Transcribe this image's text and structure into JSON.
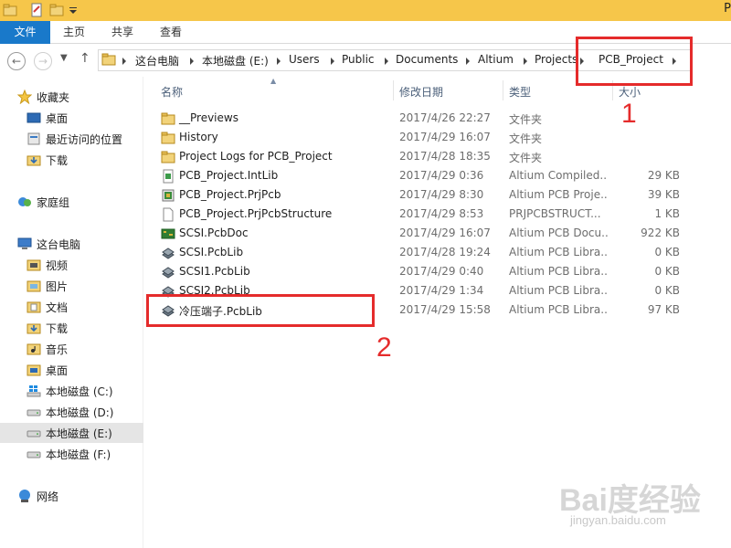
{
  "window": {
    "title_partial": "P"
  },
  "ribbon": {
    "tabs": [
      "文件",
      "主页",
      "共享",
      "查看"
    ]
  },
  "address": {
    "crumbs": [
      "这台电脑",
      "本地磁盘 (E:)",
      "Users",
      "Public",
      "Documents",
      "Altium",
      "Projects",
      "PCB_Project"
    ]
  },
  "sidebar": {
    "favorites": {
      "label": "收藏夹",
      "items": [
        "桌面",
        "最近访问的位置",
        "下载"
      ]
    },
    "homegroup": "家庭组",
    "thispc": {
      "label": "这台电脑",
      "items": [
        "视频",
        "图片",
        "文档",
        "下载",
        "音乐",
        "桌面",
        "本地磁盘 (C:)",
        "本地磁盘 (D:)",
        "本地磁盘 (E:)",
        "本地磁盘 (F:)"
      ],
      "selected": "本地磁盘 (E:)"
    },
    "network": "网络"
  },
  "filelist": {
    "columns": [
      "名称",
      "修改日期",
      "类型",
      "大小"
    ],
    "rows": [
      {
        "name": "__Previews",
        "date": "2017/4/26 22:27",
        "type": "文件夹",
        "size": "",
        "icon": "folder-icon"
      },
      {
        "name": "History",
        "date": "2017/4/29 16:07",
        "type": "文件夹",
        "size": "",
        "icon": "folder-icon"
      },
      {
        "name": "Project Logs for PCB_Project",
        "date": "2017/4/28 18:35",
        "type": "文件夹",
        "size": "",
        "icon": "folder-icon"
      },
      {
        "name": "PCB_Project.IntLib",
        "date": "2017/4/29 0:36",
        "type": "Altium Compiled...",
        "size": "29 KB",
        "icon": "intlib-icon"
      },
      {
        "name": "PCB_Project.PrjPcb",
        "date": "2017/4/29 8:30",
        "type": "Altium PCB Proje...",
        "size": "39 KB",
        "icon": "prjpcb-icon"
      },
      {
        "name": "PCB_Project.PrjPcbStructure",
        "date": "2017/4/29 8:53",
        "type": "PRJPCBSTRUCT...",
        "size": "1 KB",
        "icon": "blank-file-icon"
      },
      {
        "name": "SCSI.PcbDoc",
        "date": "2017/4/29 16:07",
        "type": "Altium PCB Docu...",
        "size": "922 KB",
        "icon": "pcbdoc-icon"
      },
      {
        "name": "SCSI.PcbLib",
        "date": "2017/4/28 19:24",
        "type": "Altium PCB Libra...",
        "size": "0 KB",
        "icon": "pcblib-icon"
      },
      {
        "name": "SCSI1.PcbLib",
        "date": "2017/4/29 0:40",
        "type": "Altium PCB Libra...",
        "size": "0 KB",
        "icon": "pcblib-icon"
      },
      {
        "name": "SCSI2.PcbLib",
        "date": "2017/4/29 1:34",
        "type": "Altium PCB Libra...",
        "size": "0 KB",
        "icon": "pcblib-icon"
      },
      {
        "name": "冷压端子.PcbLib",
        "date": "2017/4/29 15:58",
        "type": "Altium PCB Libra...",
        "size": "97 KB",
        "icon": "pcblib-icon"
      }
    ]
  },
  "annotations": {
    "label1": "1",
    "label2": "2",
    "color": "#e52b2b"
  },
  "watermark": {
    "main": "Bai度经验",
    "sub": "jingyan.baidu.com"
  },
  "colors": {
    "titlebar": "#f6c64a",
    "file_tab": "#1979ca",
    "selected_nav": "#e5e5e5"
  }
}
